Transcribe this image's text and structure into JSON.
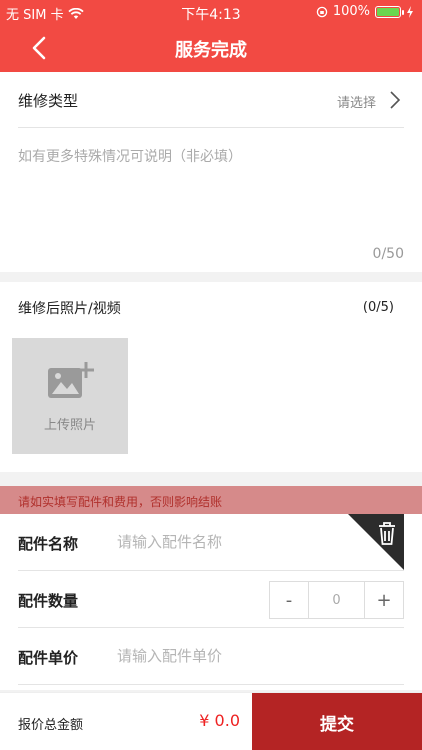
{
  "status_bar": {
    "carrier": "无 SIM 卡",
    "time": "下午4:13",
    "battery": "100%"
  },
  "nav": {
    "title": "服务完成"
  },
  "repair_type": {
    "label": "维修类型",
    "value": "请选择"
  },
  "remark": {
    "placeholder": "如有更多特殊情况可说明（非必填）",
    "value": "",
    "count": "0/50"
  },
  "media": {
    "label": "维修后照片/视频",
    "count": "(0/5)",
    "upload_label": "上传照片"
  },
  "notice": "请如实填写配件和费用，否则影响结账",
  "parts": {
    "name_label": "配件名称",
    "name_placeholder": "请输入配件名称",
    "qty_label": "配件数量",
    "qty_minus": "-",
    "qty_value": "0",
    "qty_plus": "+",
    "price_label": "配件单价",
    "price_placeholder": "请输入配件单价"
  },
  "footer": {
    "total_label": "报价总金额",
    "total_value": "¥ 0.0",
    "submit_label": "提交"
  },
  "colors": {
    "brand": "#f24a43",
    "submit": "#b42424",
    "notice_bg": "#d68a8a"
  }
}
